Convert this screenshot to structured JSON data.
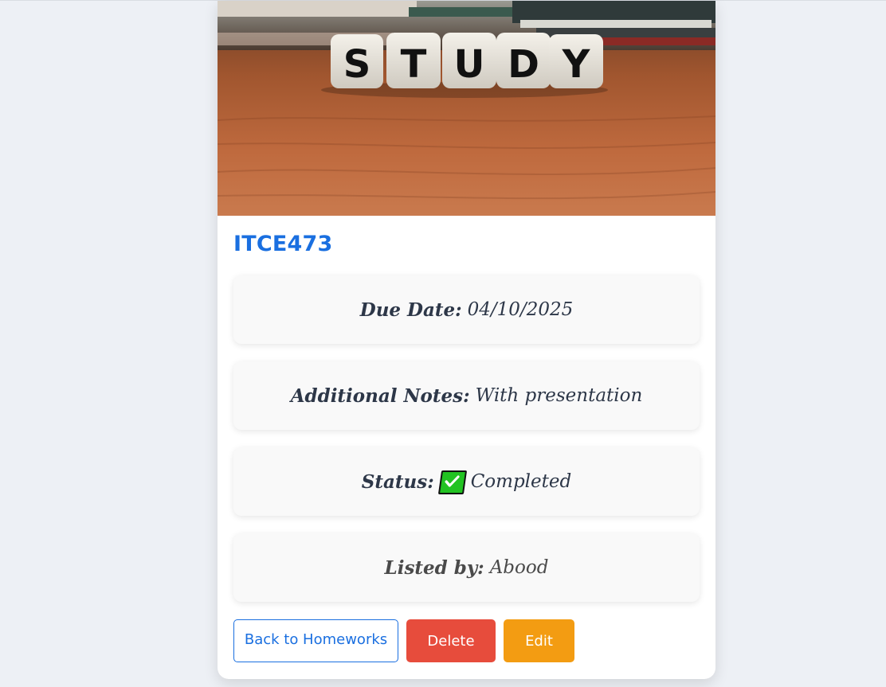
{
  "homework": {
    "title": "ITCE473",
    "hero_image_text": "STUDY",
    "due_date_label": "Due Date:",
    "due_date_value": "04/10/2025",
    "notes_label": "Additional Notes:",
    "notes_value": "With presentation",
    "status_label": "Status:",
    "status_icon": "check-box-icon",
    "status_value": "Completed",
    "listed_by_label": "Listed by:",
    "listed_by_value": "Abood"
  },
  "actions": {
    "back_label": "Back to Homeworks",
    "delete_label": "Delete",
    "edit_label": "Edit"
  },
  "colors": {
    "accent": "#1a6fe0",
    "delete": "#e74c3c",
    "edit": "#f39c12",
    "status_check": "#22c322",
    "page_bg": "#edf0f5"
  }
}
